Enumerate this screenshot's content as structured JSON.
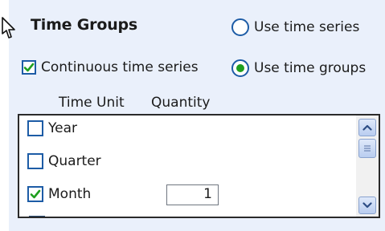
{
  "panel": {
    "title": "Time Groups",
    "continuous": {
      "label": "Continuous time series",
      "checked": true
    },
    "mode_options": [
      {
        "label": "Use time series",
        "selected": false
      },
      {
        "label": "Use time groups",
        "selected": true
      }
    ],
    "columns": {
      "unit": "Time Unit",
      "quantity": "Quantity"
    },
    "units": [
      {
        "label": "Year",
        "checked": false
      },
      {
        "label": "Quarter",
        "checked": false
      },
      {
        "label": "Month",
        "checked": true,
        "quantity": "1"
      }
    ]
  },
  "icons": {
    "cursor": "mouse-pointer-icon",
    "check": "checkmark-icon",
    "scroll_up": "chevron-up-icon",
    "scroll_down": "chevron-down-icon",
    "thumb": "scroll-grip-icon"
  },
  "colors": {
    "panel_bg": "#eaf0fb",
    "checkbox_border": "#1d5ca6",
    "check_mark": "#1f9f1f"
  }
}
